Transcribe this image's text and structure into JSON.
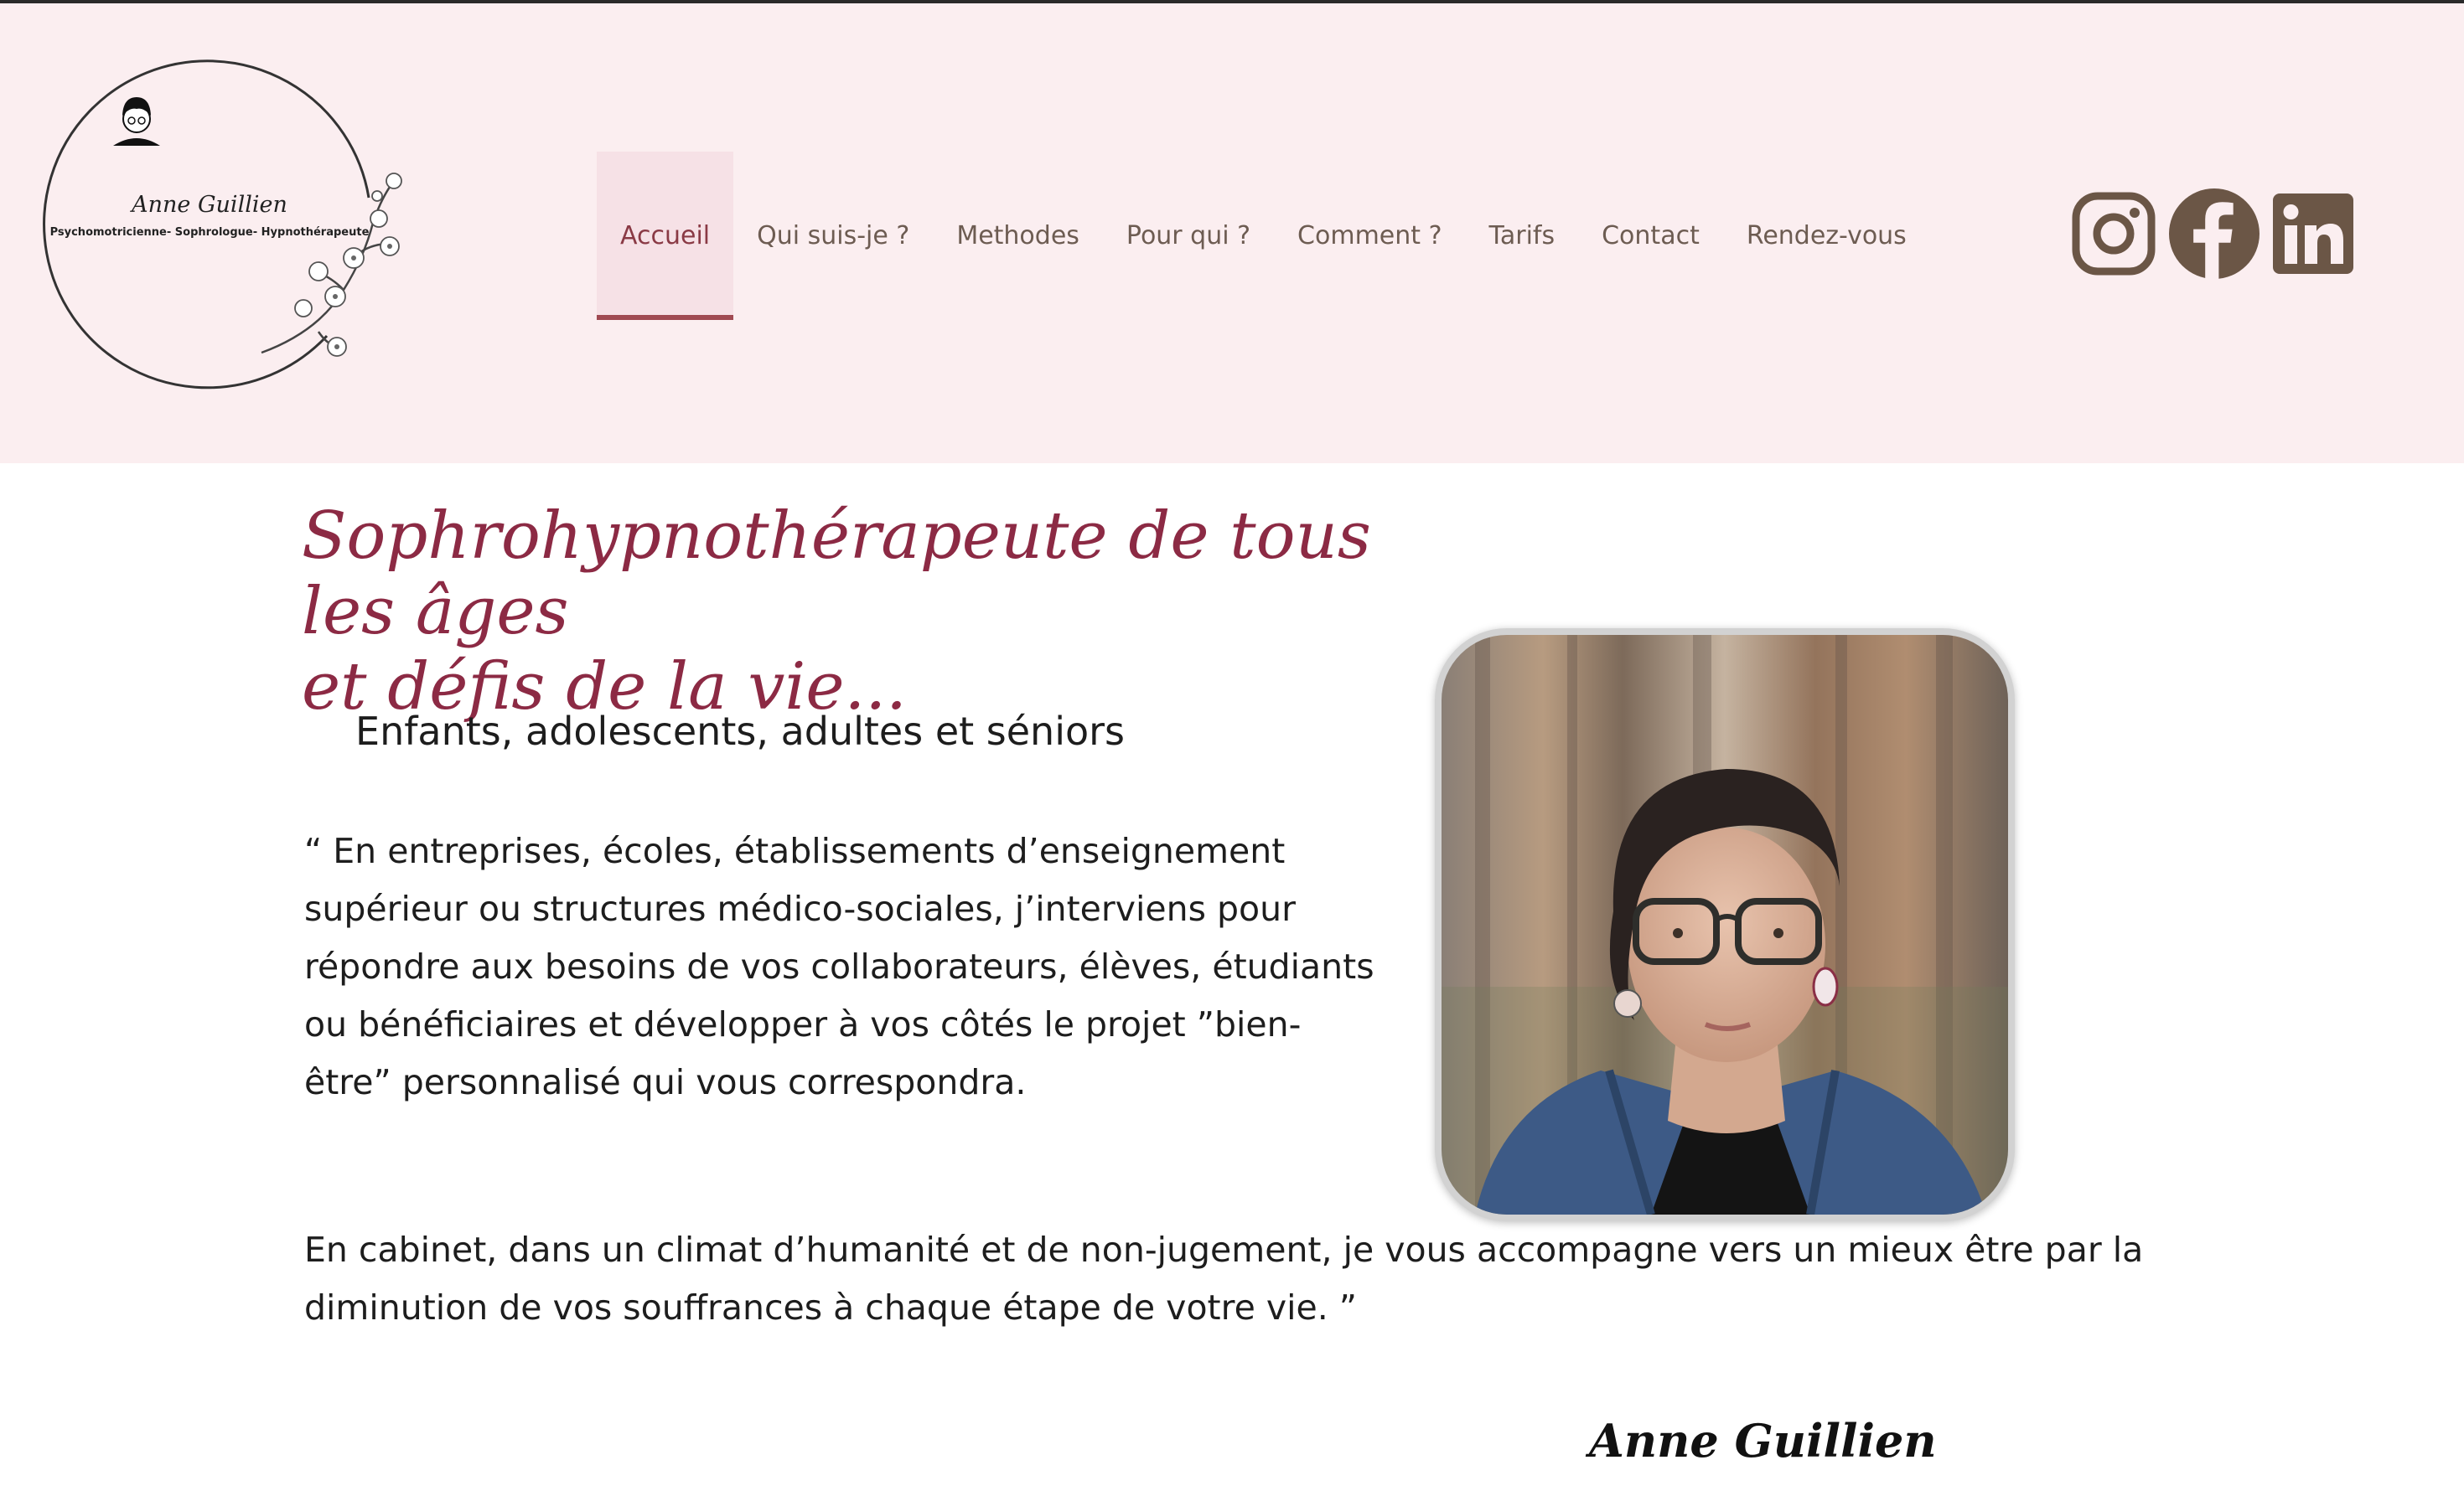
{
  "logo": {
    "name": "Anne Guillien",
    "subtitle": "Psychomotricienne- Sophrologue- Hypnothérapeute"
  },
  "nav": {
    "items": [
      {
        "label": "Accueil",
        "active": true
      },
      {
        "label": "Qui suis-je ?",
        "active": false
      },
      {
        "label": "Methodes",
        "active": false
      },
      {
        "label": "Pour qui ?",
        "active": false
      },
      {
        "label": "Comment ?",
        "active": false
      },
      {
        "label": "Tarifs",
        "active": false
      },
      {
        "label": "Contact",
        "active": false
      },
      {
        "label": "Rendez-vous",
        "active": false
      }
    ]
  },
  "social": {
    "icons": [
      "instagram-icon",
      "facebook-icon",
      "linkedin-icon"
    ],
    "color": "#6b5646"
  },
  "main": {
    "headline_line1": "Sophrohypnothérapeute de tous les âges",
    "headline_line2": "et défis de la vie...",
    "subtitle": "Enfants, adolescents, adultes et séniors",
    "quote": "“ En entreprises, écoles, établissements d’enseignement supérieur ou structures médico-sociales, j’interviens pour répondre aux besoins de vos collaborateurs, élèves, étudiants ou bénéficiaires et développer à vos côtés le projet ”bien-être” personnalisé qui vous correspondra.",
    "paragraph": "En cabinet, dans un climat d’humanité et de non-jugement, je vous accompagne vers un mieux être par la diminution de vos souffrances à chaque étape de votre vie. ”",
    "signature": "Anne Guillien"
  },
  "colors": {
    "header_bg": "#fbeef0",
    "headline": "#8c2a44",
    "nav_text": "#6d5c52",
    "nav_active_bg": "#f6e1e6",
    "nav_active_border": "#a04a52"
  }
}
